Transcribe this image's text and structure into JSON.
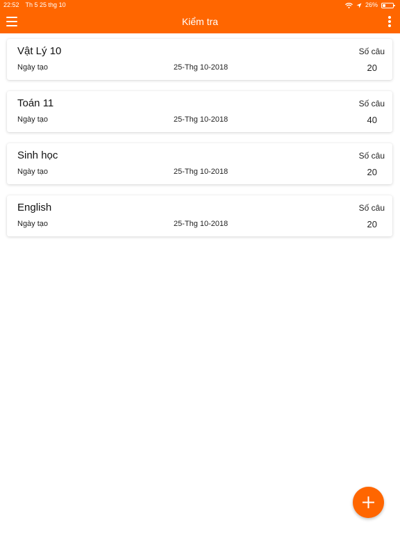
{
  "status_bar": {
    "time": "22:52",
    "date": "Th 5 25 thg 10",
    "battery_text": "26%",
    "battery_level": 0.26,
    "icons": [
      "wifi-icon",
      "location-icon",
      "battery-icon"
    ]
  },
  "app_bar": {
    "title": "Kiểm tra",
    "left_icon": "menu-icon",
    "right_icon": "more-vertical-icon"
  },
  "tests": [
    {
      "name": "Vật Lý 10",
      "created_label": "Ngày tạo",
      "created_date": "25-Thg 10-2018",
      "count_label": "Số câu",
      "count": "20"
    },
    {
      "name": "Toán 11",
      "created_label": "Ngày tạo",
      "created_date": "25-Thg 10-2018",
      "count_label": "Số câu",
      "count": "40"
    },
    {
      "name": "Sinh học",
      "created_label": "Ngày tạo",
      "created_date": "25-Thg 10-2018",
      "count_label": "Số câu",
      "count": "20"
    },
    {
      "name": "English",
      "created_label": "Ngày tạo",
      "created_date": "25-Thg 10-2018",
      "count_label": "Số câu",
      "count": "20"
    }
  ],
  "fab": {
    "icon": "plus-icon"
  },
  "colors": {
    "accent": "#ff6600",
    "background": "#ffffff",
    "text": "#111111"
  }
}
